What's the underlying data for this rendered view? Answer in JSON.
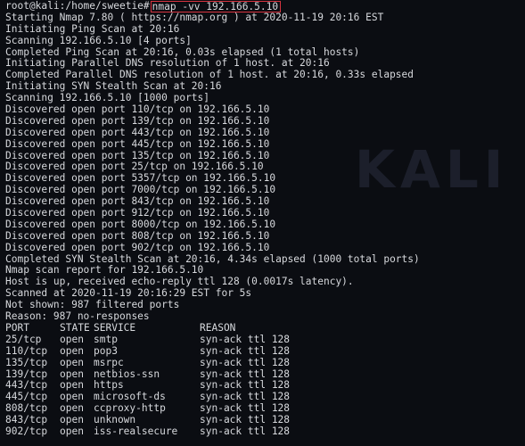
{
  "prompt": {
    "text": "root@kali:/home/sweetie#",
    "command": "nmap -vv 192.166.5.10"
  },
  "output_lines": [
    "Starting Nmap 7.80 ( https://nmap.org ) at 2020-11-19 20:16 EST",
    "Initiating Ping Scan at 20:16",
    "Scanning 192.166.5.10 [4 ports]",
    "Completed Ping Scan at 20:16, 0.03s elapsed (1 total hosts)",
    "Initiating Parallel DNS resolution of 1 host. at 20:16",
    "Completed Parallel DNS resolution of 1 host. at 20:16, 0.33s elapsed",
    "Initiating SYN Stealth Scan at 20:16",
    "Scanning 192.166.5.10 [1000 ports]",
    "Discovered open port 110/tcp on 192.166.5.10",
    "Discovered open port 139/tcp on 192.166.5.10",
    "Discovered open port 443/tcp on 192.166.5.10",
    "Discovered open port 445/tcp on 192.166.5.10",
    "Discovered open port 135/tcp on 192.166.5.10",
    "Discovered open port 25/tcp on 192.166.5.10",
    "Discovered open port 5357/tcp on 192.166.5.10",
    "Discovered open port 7000/tcp on 192.166.5.10",
    "Discovered open port 843/tcp on 192.166.5.10",
    "Discovered open port 912/tcp on 192.166.5.10",
    "Discovered open port 8000/tcp on 192.166.5.10",
    "Discovered open port 808/tcp on 192.166.5.10",
    "Discovered open port 902/tcp on 192.166.5.10",
    "Completed SYN Stealth Scan at 20:16, 4.34s elapsed (1000 total ports)",
    "Nmap scan report for 192.166.5.10",
    "Host is up, received echo-reply ttl 128 (0.0017s latency).",
    "Scanned at 2020-11-19 20:16:29 EST for 5s",
    "Not shown: 987 filtered ports",
    "Reason: 987 no-responses"
  ],
  "table": {
    "headers": {
      "port": "PORT",
      "state": "STATE",
      "service": "SERVICE",
      "reason": "REASON"
    },
    "rows": [
      {
        "port": "25/tcp",
        "state": "open",
        "service": "smtp",
        "reason": "syn-ack ttl 128"
      },
      {
        "port": "110/tcp",
        "state": "open",
        "service": "pop3",
        "reason": "syn-ack ttl 128"
      },
      {
        "port": "135/tcp",
        "state": "open",
        "service": "msrpc",
        "reason": "syn-ack ttl 128"
      },
      {
        "port": "139/tcp",
        "state": "open",
        "service": "netbios-ssn",
        "reason": "syn-ack ttl 128"
      },
      {
        "port": "443/tcp",
        "state": "open",
        "service": "https",
        "reason": "syn-ack ttl 128"
      },
      {
        "port": "445/tcp",
        "state": "open",
        "service": "microsoft-ds",
        "reason": "syn-ack ttl 128"
      },
      {
        "port": "808/tcp",
        "state": "open",
        "service": "ccproxy-http",
        "reason": "syn-ack ttl 128"
      },
      {
        "port": "843/tcp",
        "state": "open",
        "service": "unknown",
        "reason": "syn-ack ttl 128"
      },
      {
        "port": "902/tcp",
        "state": "open",
        "service": "iss-realsecure",
        "reason": "syn-ack ttl 128"
      }
    ]
  },
  "watermark": "KALI LI",
  "colors": {
    "background": "#0b0d12",
    "text": "#d7d9dd",
    "highlight_border": "#d7333f"
  }
}
